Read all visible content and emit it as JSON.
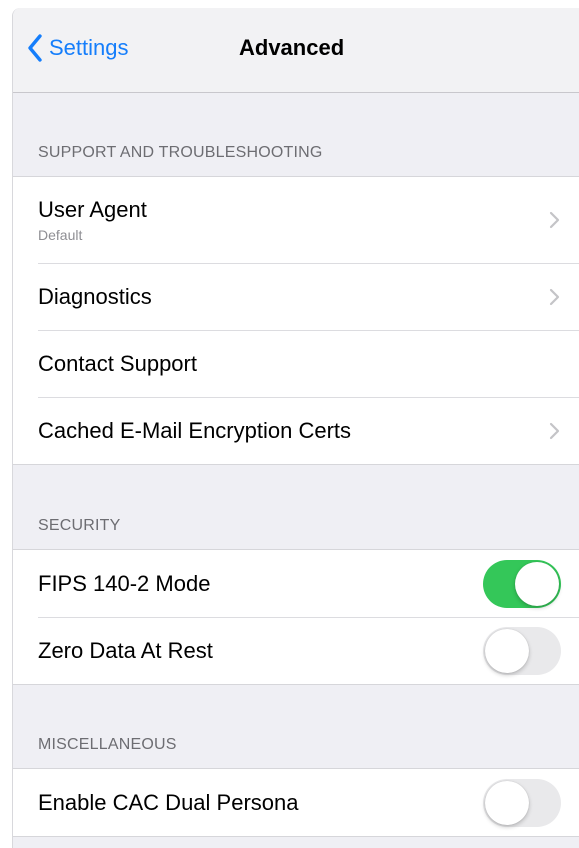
{
  "nav": {
    "back_label": "Settings",
    "title": "Advanced"
  },
  "sections": {
    "support": {
      "header": "SUPPORT AND TROUBLESHOOTING",
      "user_agent": {
        "label": "User Agent",
        "subtitle": "Default"
      },
      "diagnostics": {
        "label": "Diagnostics"
      },
      "contact_support": {
        "label": "Contact Support"
      },
      "cached_certs": {
        "label": "Cached E-Mail Encryption Certs"
      }
    },
    "security": {
      "header": "SECURITY",
      "fips": {
        "label": "FIPS 140-2 Mode",
        "enabled": true
      },
      "zero_data": {
        "label": "Zero Data At Rest",
        "enabled": false
      }
    },
    "misc": {
      "header": "MISCELLANEOUS",
      "cac_dual_persona": {
        "label": "Enable CAC Dual Persona",
        "enabled": false
      }
    }
  },
  "colors": {
    "accent": "#157efb",
    "toggle_on": "#34c759",
    "toggle_off": "#e9e9eb",
    "group_background": "#efeff4"
  },
  "icons": {
    "back": "chevron-left-icon",
    "disclosure": "chevron-right-icon"
  }
}
